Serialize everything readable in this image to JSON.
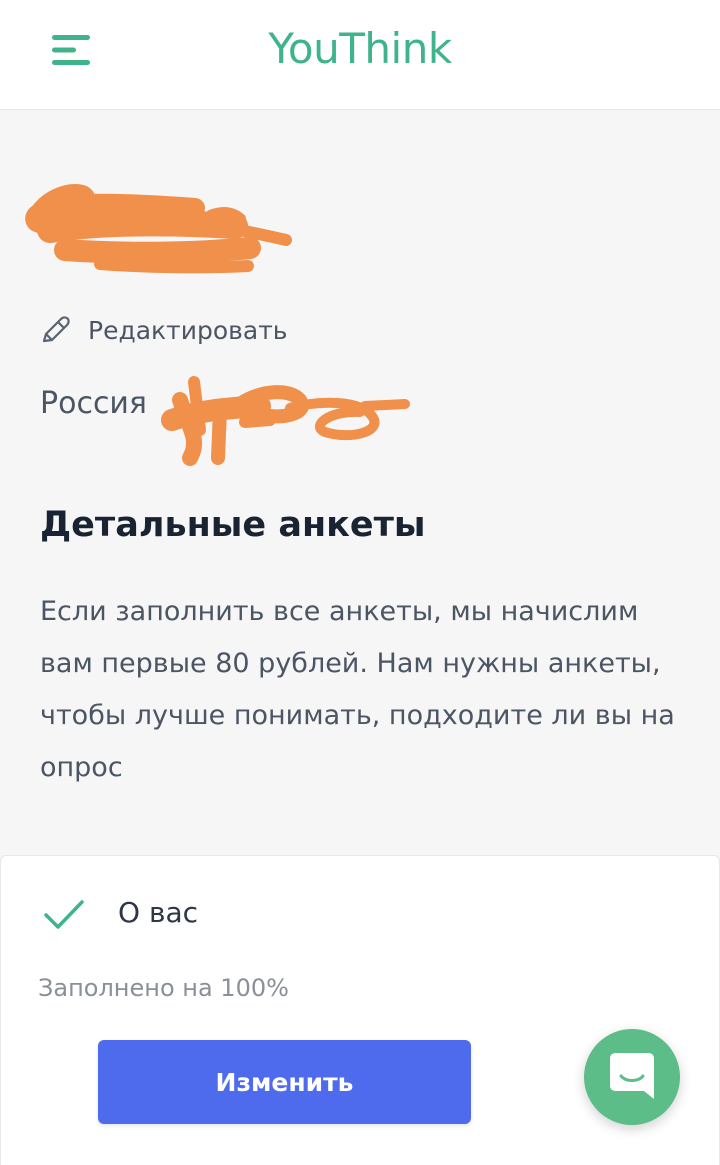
{
  "header": {
    "logo_text": "YouThink",
    "menu_icon": "hamburger-menu-icon"
  },
  "profile": {
    "edit_label": "Редактировать",
    "edit_icon": "pencil-icon",
    "country": "Россия"
  },
  "surveys": {
    "title": "Детальные анкеты",
    "description": "Если заполнить все анкеты, мы начислим вам первые 80 рублей. Нам нужны анкеты, чтобы лучше понимать, подходите ли вы на опрос"
  },
  "card": {
    "status_icon": "checkmark-icon",
    "title": "О вас",
    "progress_text": "Заполнено на 100%",
    "progress_value": 100,
    "button_label": "Изменить"
  },
  "chat": {
    "icon": "chat-bubble-icon"
  },
  "colors": {
    "brand_green": "#3fb38a",
    "button_blue": "#4f6bed",
    "chat_green": "#5cbd88",
    "redaction_orange": "#f0904a",
    "background": "#f6f6f7"
  }
}
